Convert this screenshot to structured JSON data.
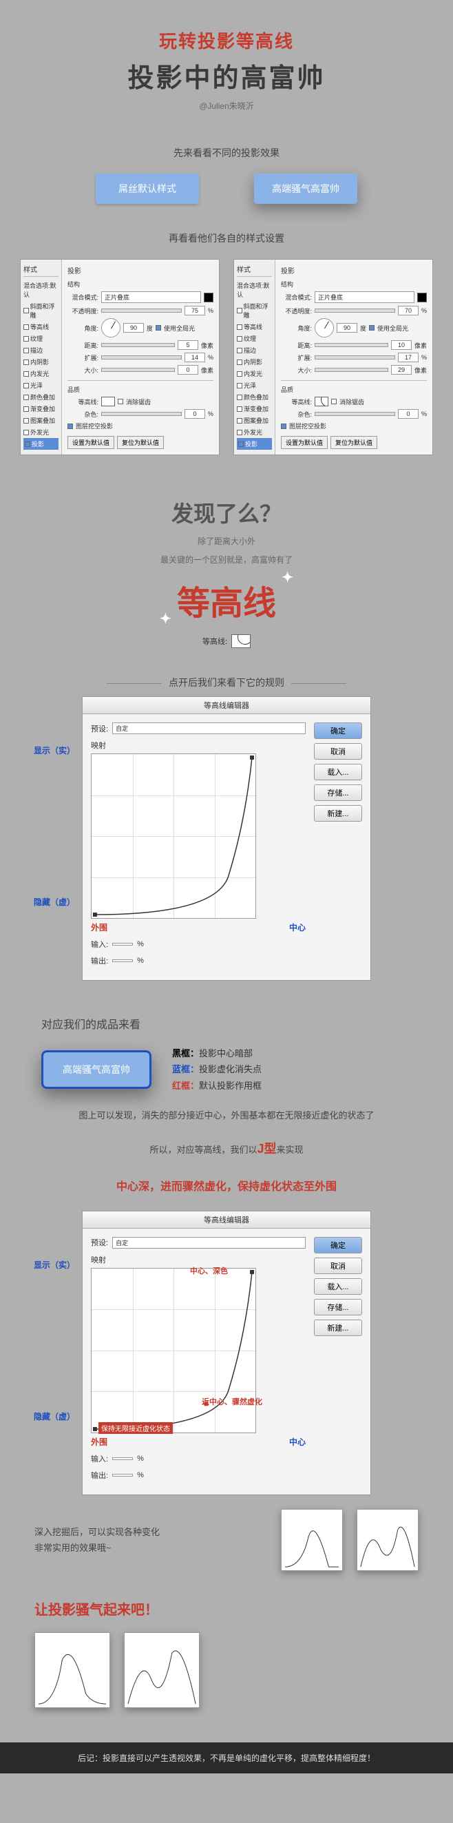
{
  "hero": {
    "title1": "玩转投影等高线",
    "title2": "投影中的高富帅",
    "author": "@Julien朱晓沂"
  },
  "section1_label": "先来看看不同的投影效果",
  "buttons": {
    "flat": "屌丝默认样式",
    "rich": "高端骚气高富帅"
  },
  "section2_label": "再看看他们各自的样式设置",
  "panel": {
    "side_title": "样式",
    "side_items": [
      "混合选项:默认",
      "斜面和浮雕",
      "等高线",
      "纹理",
      "描边",
      "内阴影",
      "内发光",
      "光泽",
      "颜色叠加",
      "渐变叠加",
      "图案叠加",
      "外发光",
      "投影"
    ],
    "main_title": "投影",
    "struct_title": "结构",
    "blend_label": "混合模式:",
    "blend_value": "正片叠底",
    "opacity_label": "不透明度:",
    "opacity_left": "75",
    "opacity_right": "70",
    "angle_label": "角度:",
    "angle_value": "90",
    "global_light": "使用全局光",
    "distance_label": "距离:",
    "distance_left": "5",
    "distance_right": "10",
    "spread_label": "扩展:",
    "spread_left": "14",
    "spread_right": "17",
    "size_label": "大小:",
    "size_left": "0",
    "size_right": "29",
    "quality_title": "品质",
    "contour_label": "等高线:",
    "anti_alias": "消除锯齿",
    "noise_label": "杂色:",
    "noise_value": "0",
    "knockout": "图层挖空投影",
    "btn_default": "设置为默认值",
    "btn_reset": "复位为默认值",
    "px": "像素",
    "pct": "%",
    "deg": "度"
  },
  "discover": {
    "q": "发现了么？",
    "sub1": "除了距离大小外",
    "sub2": "最关键的一个区别就是，高富帅有了",
    "big": "等高线",
    "demo_label": "等高线:"
  },
  "rules_label": "点开后我们来看下它的规则",
  "editor": {
    "title": "等高线编辑器",
    "preset_label": "预设:",
    "preset_value": "自定",
    "mapping_label": "映射",
    "input_label": "输入:",
    "output_label": "输出:",
    "pct": "%",
    "btn_ok": "确定",
    "btn_cancel": "取消",
    "btn_load": "载入...",
    "btn_save": "存储...",
    "btn_new": "新建..."
  },
  "ann1": {
    "show": "显示（实）",
    "hide": "隐藏（虚）",
    "outer": "外围",
    "center": "中心"
  },
  "result_label": "对应我们的成品来看",
  "btn_fancy": "高端骚气高富帅",
  "legend": {
    "black_k": "黑框：",
    "black_v": "投影中心暗部",
    "blue_k": "蓝框：",
    "blue_v": "投影虚化消失点",
    "red_k": "红框：",
    "red_v": "默认投影作用框"
  },
  "body1": "图上可以发现，消失的部分接近中心，外围基本都在无限接近虚化的状态了",
  "body2_a": "所以，对应等高线，我们以",
  "body2_j": "J型",
  "body2_b": "来实现",
  "red_statement": "中心深，进而骤然虚化，保持虚化状态至外围",
  "ann2": {
    "center_deep": "中心、深色",
    "near_center": "近中心、骤然虚化",
    "keep_virtual": "保持无限接近虚化状态"
  },
  "final": {
    "text1": "深入挖掘后，可以实现各种变化",
    "text2": "非常实用的效果哦~"
  },
  "cta": "让投影骚气起来吧！",
  "footer": "后记：投影直接可以产生透视效果，不再是单纯的虚化平移，提高整体精细程度！"
}
